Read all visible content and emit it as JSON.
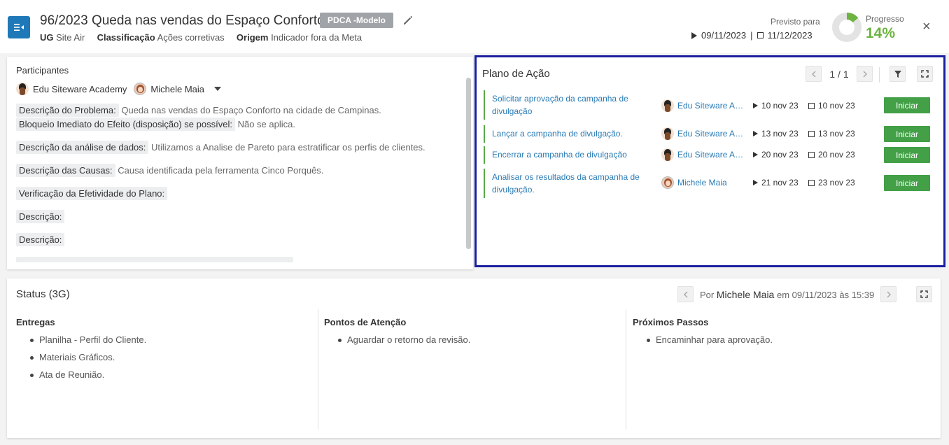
{
  "header": {
    "title": "96/2023 Queda nas vendas do Espaço Conforto",
    "tag": "PDCA -Modelo",
    "meta": [
      {
        "label": "UG",
        "value": "Site Air"
      },
      {
        "label": "Classificação",
        "value": "Ações corretivas"
      },
      {
        "label": "Origem",
        "value": "Indicador fora da Meta"
      }
    ],
    "previsto_label": "Previsto para",
    "date_start": "09/11/2023",
    "date_sep": "|",
    "date_end": "11/12/2023",
    "progress_label": "Progresso",
    "progress_value": "14%",
    "progress_fraction": 0.14,
    "close_label": "×"
  },
  "participants": {
    "title": "Participantes",
    "people": [
      "Edu Siteware Academy",
      "Michele Maia"
    ]
  },
  "fields": [
    {
      "label": "Descrição do Problema:",
      "value": "Queda nas vendas do Espaço Conforto na cidade de Campinas."
    },
    {
      "label": "Bloqueio Imediato do Efeito (disposição) se possível:",
      "value": "Não se aplica."
    },
    {
      "label": "Descrição da análise de dados:",
      "value": "Utilizamos a Analise de Pareto para estratificar os perfis de clientes."
    },
    {
      "label": "Descrição das Causas:",
      "value": "Causa identificada pela ferramenta Cinco Porquês."
    },
    {
      "label": "Verificação da Efetividade do Plano:",
      "value": ""
    },
    {
      "label": "Descrição:",
      "value": ""
    },
    {
      "label": "Descrição:",
      "value": ""
    }
  ],
  "plan": {
    "title": "Plano de Ação",
    "pager": "1 / 1",
    "tasks": [
      {
        "name": "Solicitar aprovação da campanha de divulgação",
        "owner": "Edu Siteware Ac...",
        "start": "10 nov 23",
        "end": "10 nov 23",
        "action": "Iniciar"
      },
      {
        "name": "Lançar a campanha de divulgação.",
        "owner": "Edu Siteware Ac...",
        "start": "13 nov 23",
        "end": "13 nov 23",
        "action": "Iniciar"
      },
      {
        "name": "Encerrar a campanha de divulgação",
        "owner": "Edu Siteware Ac...",
        "start": "20 nov 23",
        "end": "20 nov 23",
        "action": "Iniciar"
      },
      {
        "name": "Analisar os resultados da campanha de divulgação.",
        "owner": "Michele Maia",
        "start": "21 nov 23",
        "end": "23 nov 23",
        "action": "Iniciar"
      }
    ]
  },
  "status": {
    "title": "Status (3G)",
    "by_prefix": "Por",
    "by_name": "Michele Maia",
    "by_suffix": "em 09/11/2023 às 15:39",
    "columns": [
      {
        "title": "Entregas",
        "items": [
          "Planilha - Perfil do Cliente.",
          "Materiais Gráficos.",
          "Ata de Reunião."
        ]
      },
      {
        "title": "Pontos de Atenção",
        "items": [
          "Aguardar o retorno da revisão."
        ]
      },
      {
        "title": "Próximos Passos",
        "items": [
          "Encaminhar para aprovação."
        ]
      }
    ]
  },
  "colors": {
    "accent_blue": "#1f79b8",
    "progress_green": "#6cb33f",
    "button_green": "#43a047",
    "link_blue": "#2a7bb5",
    "highlight_border": "#1a1f9e"
  }
}
